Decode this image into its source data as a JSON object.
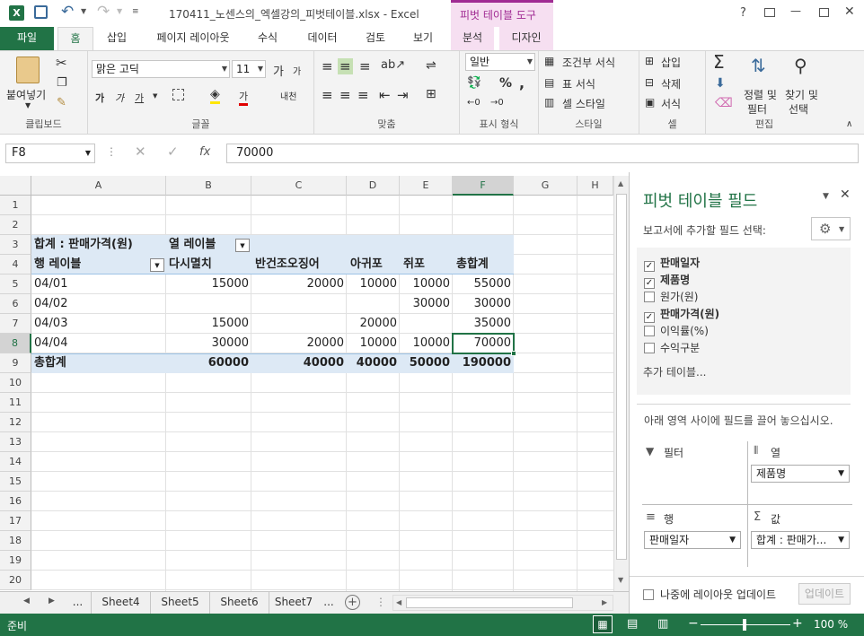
{
  "window": {
    "title": "170411_노센스의_엑셀강의_피벗테이블.xlsx - Excel",
    "context_tab_group": "피벗 테이블 도구",
    "controls": {
      "help": "?",
      "minimize": "—",
      "close": "✕"
    }
  },
  "tabs": [
    "파일",
    "홈",
    "삽입",
    "페이지 레이아웃",
    "수식",
    "데이터",
    "검토",
    "보기",
    "분석",
    "디자인"
  ],
  "ribbon": {
    "clipboard": {
      "paste": "붙여넣기",
      "label": "클립보드"
    },
    "font": {
      "name": "맑은 고딕",
      "size": "11",
      "bold": "가",
      "italic": "가",
      "underline": "가",
      "grow": "가",
      "shrink": "가",
      "fontcolor": "가",
      "phonetic": "내천",
      "label": "글꼴"
    },
    "align": {
      "label": "맞춤"
    },
    "number": {
      "format": "일반",
      "percent": "%",
      "comma": ",",
      "label": "표시 형식"
    },
    "styles": {
      "conditional": "조건부 서식",
      "table": "표 서식",
      "cell": "셀 스타일",
      "label": "스타일"
    },
    "cells": {
      "insert": "삽입",
      "delete": "삭제",
      "format": "서식",
      "label": "셀"
    },
    "editing": {
      "sort_line1": "정렬 및",
      "sort_line2": "필터",
      "find_line1": "찾기 및",
      "find_line2": "선택",
      "label": "편집"
    }
  },
  "formula_bar": {
    "name_box": "F8",
    "fx": "fx",
    "value": "70000"
  },
  "columns": [
    "A",
    "B",
    "C",
    "D",
    "E",
    "F",
    "G",
    "H"
  ],
  "rows": [
    "1",
    "2",
    "3",
    "4",
    "5",
    "6",
    "7",
    "8",
    "9",
    "10",
    "11",
    "12",
    "13",
    "14",
    "15",
    "16",
    "17",
    "18",
    "19",
    "20"
  ],
  "pivot": {
    "values_label": "합계 : 판매가격(원)",
    "column_labels": "열 레이블",
    "row_labels": "행 레이블",
    "headers": [
      "다시멸치",
      "반건조오징어",
      "아귀포",
      "쥐포",
      "총합계"
    ],
    "data": [
      {
        "label": "04/01",
        "cells": [
          "15000",
          "20000",
          "10000",
          "10000",
          "55000"
        ]
      },
      {
        "label": "04/02",
        "cells": [
          "",
          "",
          "",
          "30000",
          "30000"
        ]
      },
      {
        "label": "04/03",
        "cells": [
          "15000",
          "",
          "20000",
          "",
          "35000"
        ]
      },
      {
        "label": "04/04",
        "cells": [
          "30000",
          "20000",
          "10000",
          "10000",
          "70000"
        ]
      }
    ],
    "total": {
      "label": "총합계",
      "cells": [
        "60000",
        "40000",
        "40000",
        "50000",
        "190000"
      ]
    }
  },
  "sheet_tabs": [
    "...",
    "Sheet4",
    "Sheet5",
    "Sheet6",
    "Sheet7",
    "..."
  ],
  "status": {
    "ready": "준비",
    "zoom": "100 %"
  },
  "pane": {
    "title": "피벗 테이블 필드",
    "subtitle": "보고서에 추가할 필드 선택:",
    "fields": [
      {
        "name": "판매일자",
        "checked": true
      },
      {
        "name": "제품명",
        "checked": true
      },
      {
        "name": "원가(원)",
        "checked": false
      },
      {
        "name": "판매가격(원)",
        "checked": true
      },
      {
        "name": "이익률(%)",
        "checked": false
      },
      {
        "name": "수익구분",
        "checked": false
      }
    ],
    "more_tables": "추가 테이블...",
    "drag_hint": "아래 영역 사이에 필드를 끌어 놓으십시오.",
    "areas": {
      "filter": "필터",
      "columns": "열",
      "columns_value": "제품명",
      "rows": "행",
      "rows_value": "판매일자",
      "values": "값",
      "values_value": "합계 : 판매가..."
    },
    "defer": "나중에 레이아웃 업데이트",
    "update": "업데이트"
  },
  "colors": {
    "excel_green": "#217346",
    "pivot_tint": "#dde9f5",
    "context_pink": "#f6dff1",
    "context_text": "#a02b93"
  }
}
